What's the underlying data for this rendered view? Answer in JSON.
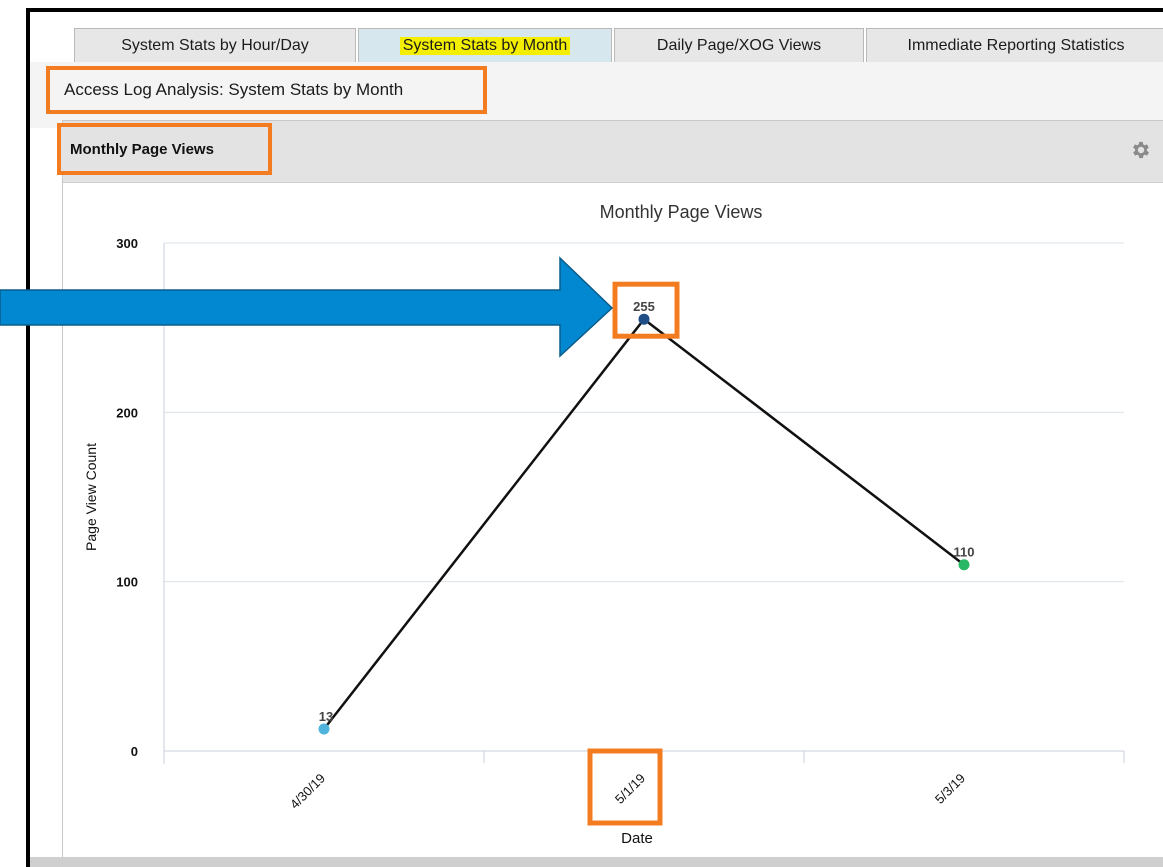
{
  "tabs": [
    {
      "label": "System Stats by Hour/Day",
      "active": false
    },
    {
      "label": "System Stats by Month",
      "active": true
    },
    {
      "label": "Daily Page/XOG Views",
      "active": false
    },
    {
      "label": "Immediate Reporting Statistics",
      "active": false
    }
  ],
  "page_title": "Access Log Analysis: System Stats by Month",
  "portlet": {
    "title": "Monthly Page Views",
    "settings_icon": "gear-icon"
  },
  "corner_glyph": "n",
  "arrow_icon": "arrow-right-icon",
  "colors": {
    "highlight_box": "#f47c20",
    "arrow": "#0288d1",
    "tab_highlight": "#f4ef00",
    "line": "#111111"
  },
  "chart_data": {
    "type": "line",
    "title": "Monthly Page Views",
    "xlabel": "Date",
    "ylabel": "Page View Count",
    "ylim": [
      0,
      300
    ],
    "yticks": [
      0,
      100,
      200,
      300
    ],
    "grid": true,
    "categories": [
      "4/30/19",
      "5/1/19",
      "5/3/19"
    ],
    "values": [
      13,
      255,
      110
    ],
    "data_labels": [
      "13",
      "255",
      "110"
    ],
    "point_colors": [
      "#4fb3dc",
      "#1f4f86",
      "#28b765"
    ],
    "highlighted_point": "5/1/19"
  }
}
